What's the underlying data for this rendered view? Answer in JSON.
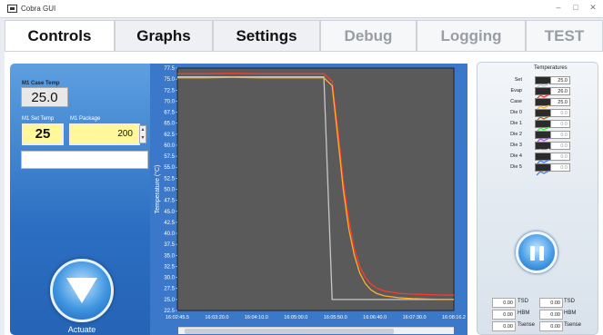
{
  "window": {
    "title": "Cobra GUI",
    "minimize": "–",
    "maximize": "□",
    "close": "✕"
  },
  "tabs": [
    {
      "label": "Controls",
      "state": "active"
    },
    {
      "label": "Graphs",
      "state": "inactive"
    },
    {
      "label": "Settings",
      "state": "inactive"
    },
    {
      "label": "Debug",
      "state": "disabled"
    },
    {
      "label": "Logging",
      "state": "disabled"
    },
    {
      "label": "TEST",
      "state": "disabled"
    }
  ],
  "controls": {
    "case_temp_label": "M1 Case Temp",
    "case_temp_value": "25.0",
    "set_temp_label": "M1 Set Temp",
    "set_temp_value": "25",
    "package_label": "M1 Package",
    "package_value": "200",
    "message_value": "",
    "actuate_label": "Actuate"
  },
  "chart_data": {
    "type": "line",
    "ylabel": "Temperature (°C)",
    "ylim": [
      22.5,
      77.5
    ],
    "yticks": [
      "77.5",
      "75.0",
      "72.5",
      "70.0",
      "67.5",
      "65.0",
      "62.5",
      "60.0",
      "57.5",
      "55.0",
      "52.5",
      "50.0",
      "47.5",
      "45.0",
      "42.5",
      "40.0",
      "37.5",
      "35.0",
      "32.5",
      "30.0",
      "27.5",
      "25.0",
      "22.5"
    ],
    "xticks": [
      "16:02:45.5",
      "16:03:20.0",
      "16:04:10.0",
      "16:05:00.0",
      "16:05:50.0",
      "16:06:40.0",
      "16:07:30.0",
      "16:08:16.2"
    ],
    "x": [
      0,
      0.1,
      0.2,
      0.3,
      0.4,
      0.5,
      0.53,
      0.56,
      0.58,
      0.6,
      0.62,
      0.64,
      0.66,
      0.68,
      0.7,
      0.72,
      0.75,
      0.8,
      0.85,
      0.9,
      0.95,
      1.0
    ],
    "grid": false,
    "series": [
      {
        "name": "Set",
        "color": "#c8c8c8",
        "values": [
          75.5,
          75.5,
          75.5,
          75.5,
          75.5,
          75.5,
          75.5,
          25,
          25,
          25,
          25,
          25,
          25,
          25,
          25,
          25,
          25,
          25,
          25,
          25,
          25,
          25
        ]
      },
      {
        "name": "Evap",
        "color": "#ff3a2a",
        "values": [
          76.2,
          76.2,
          76.3,
          76.2,
          76.2,
          76.2,
          76.2,
          74.5,
          64,
          52,
          43,
          36.5,
          32.5,
          30,
          28.5,
          27.6,
          26.9,
          26.4,
          26.2,
          26.1,
          26.0,
          26.0
        ]
      },
      {
        "name": "Case",
        "color": "#ffb02a",
        "values": [
          75.3,
          75.3,
          75.4,
          75.3,
          75.3,
          75.3,
          75.3,
          73.5,
          62,
          50,
          41,
          35,
          31,
          28.6,
          27.2,
          26.4,
          25.8,
          25.4,
          25.2,
          25.1,
          25.0,
          25.0
        ]
      }
    ]
  },
  "temperatures": {
    "header": "Temperatures",
    "rows": [
      {
        "name": "Set",
        "value": "25.0",
        "color": "#c8c8c8",
        "active": true
      },
      {
        "name": "Evap",
        "value": "26.0",
        "color": "#ff3a2a",
        "active": true
      },
      {
        "name": "Case",
        "value": "25.0",
        "color": "#ffb02a",
        "active": true
      },
      {
        "name": "Die 0",
        "value": "0.0",
        "color": "#9a6f2a",
        "active": false
      },
      {
        "name": "Die 1",
        "value": "0.0",
        "color": "#3be83b",
        "active": false
      },
      {
        "name": "Die 2",
        "value": "0.0",
        "color": "#a55bff",
        "active": false
      },
      {
        "name": "Die 3",
        "value": "0.0",
        "color": "#e8e8e8",
        "active": false
      },
      {
        "name": "Die 4",
        "value": "0.0",
        "color": "#3b7bff",
        "active": false
      },
      {
        "name": "Die 5",
        "value": "0.0",
        "color": "#5a7fb5",
        "active": false
      }
    ]
  },
  "sensors_left": [
    {
      "value": "0.00",
      "label": "TSD"
    },
    {
      "value": "0.00",
      "label": "HBM"
    },
    {
      "value": "0.00",
      "label": "Tsense"
    }
  ],
  "sensors_right": [
    {
      "value": "0.00",
      "label": "TSD"
    },
    {
      "value": "0.00",
      "label": "HBM"
    },
    {
      "value": "0.00",
      "label": "Tsense"
    }
  ]
}
